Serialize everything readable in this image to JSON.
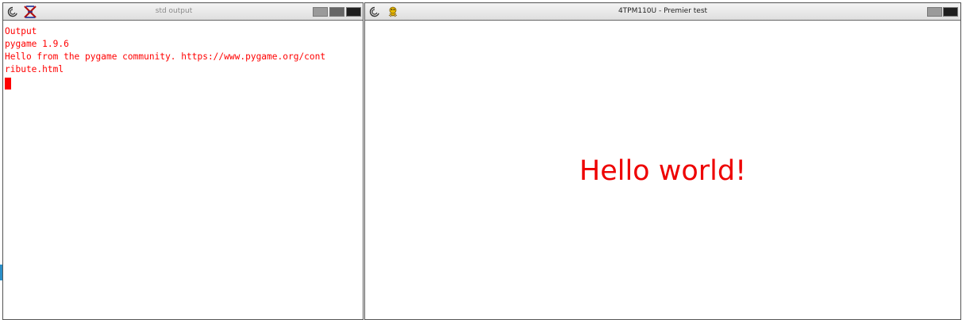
{
  "left_window": {
    "title": "std output",
    "icons": [
      "debian-swirl-icon",
      "x-logo-icon"
    ],
    "terminal_lines": [
      "Output",
      "pygame 1.9.6",
      "Hello from the pygame community. https://www.pygame.org/cont",
      "ribute.html"
    ]
  },
  "right_window": {
    "title": "4TPM110U - Premier test",
    "icons": [
      "debian-swirl-icon",
      "pygame-snake-icon"
    ],
    "canvas_text": "Hello world!"
  },
  "colors": {
    "terminal_text": "#ff0000",
    "canvas_text": "#ee0000",
    "titlebar": "#e8e8e8"
  }
}
